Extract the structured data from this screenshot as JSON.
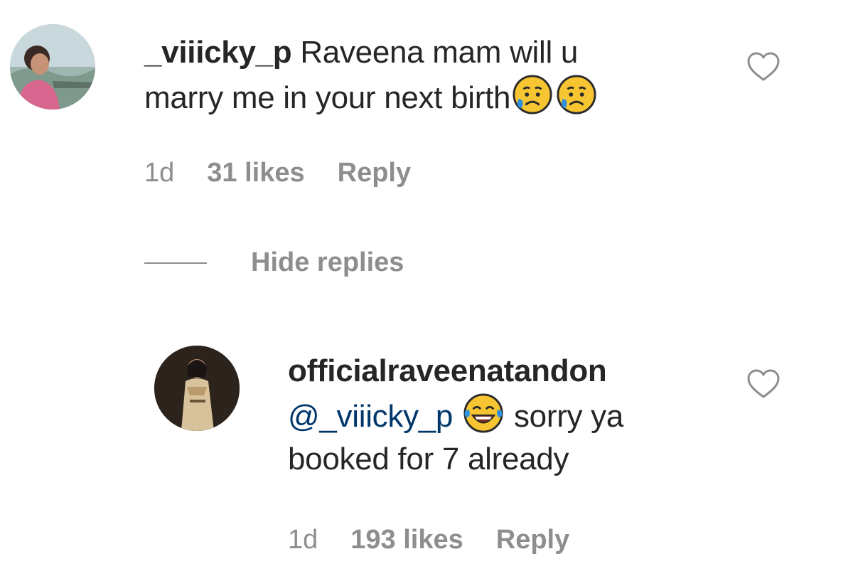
{
  "comment": {
    "username": "_viiicky_p",
    "text_line1": " Raveena mam will u",
    "text_line2": "marry me in your next birth",
    "emoji": "sad-relieved-face",
    "time": "1d",
    "likes": "31 likes",
    "reply_label": "Reply"
  },
  "thread": {
    "hide_replies_label": "Hide replies"
  },
  "reply": {
    "username": "officialraveenatandon",
    "mention": "@_viiicky_p",
    "emoji": "face-with-tears-of-joy",
    "text_line1_rest": " sorry ya",
    "text_line2": "booked for 7 already",
    "time": "1d",
    "likes": "193 likes",
    "reply_label": "Reply"
  },
  "colors": {
    "text": "#262626",
    "secondary": "#8e8e8e",
    "mention": "#00376b"
  },
  "icons": [
    "heart-outline-icon",
    "heart-outline-icon"
  ]
}
